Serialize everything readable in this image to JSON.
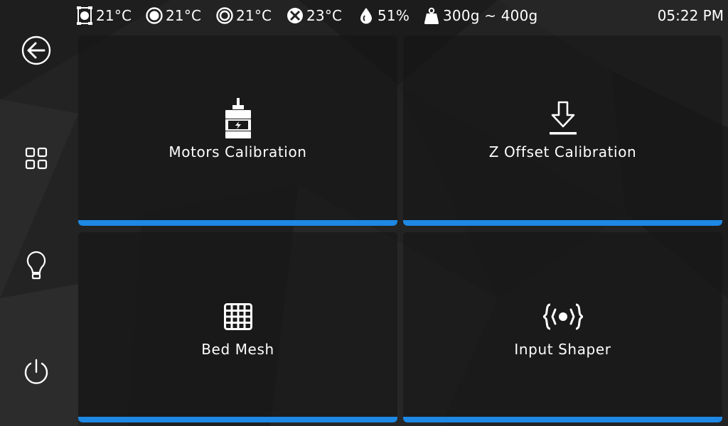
{
  "status": {
    "extruder_temp": "21°C",
    "bed_temp": "21°C",
    "chamber_temp": "21°C",
    "fan_temp": "23°C",
    "humidity": "51%",
    "filament_weight": "300g ~ 400g",
    "time": "05:22 PM"
  },
  "sidebar": {
    "items": [
      {
        "icon": "back-arrow-icon"
      },
      {
        "icon": "grid-apps-icon"
      },
      {
        "icon": "light-bulb-icon"
      },
      {
        "icon": "power-icon"
      }
    ]
  },
  "tiles": [
    {
      "label": "Motors Calibration",
      "icon": "motor-icon"
    },
    {
      "label": "Z Offset Calibration",
      "icon": "download-arrow-icon"
    },
    {
      "label": "Bed Mesh",
      "icon": "mesh-grid-icon"
    },
    {
      "label": "Input Shaper",
      "icon": "input-shaper-icon"
    }
  ],
  "colors": {
    "accent": "#1e88e5",
    "background": "#242424",
    "tile": "#1a1a1a",
    "text": "#ffffff"
  }
}
